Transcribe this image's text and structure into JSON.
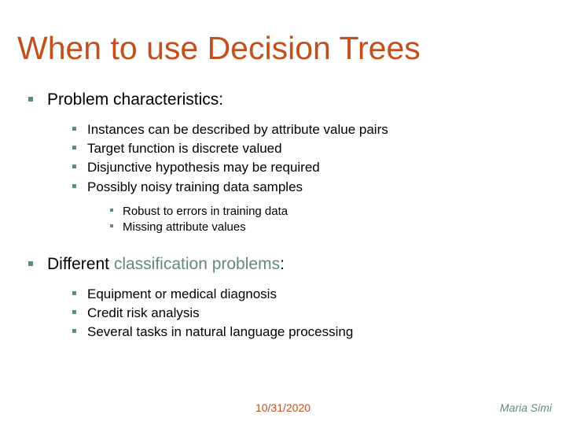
{
  "title": "When to use Decision Trees",
  "section1": {
    "heading": "Problem characteristics:",
    "items": [
      "Instances can be described by attribute value pairs",
      "Target function is discrete valued",
      "Disjunctive hypothesis may be required",
      "Possibly noisy training data samples"
    ],
    "subitems": [
      "Robust to errors in training data",
      "Missing attribute values"
    ]
  },
  "section2": {
    "heading_prefix": "Different ",
    "heading_teal": "classification problems",
    "heading_suffix": ":",
    "items": [
      "Equipment or medical diagnosis",
      "Credit risk analysis",
      "Several tasks in natural language processing"
    ]
  },
  "footer": {
    "date": "10/31/2020",
    "author": "Maria Simi"
  }
}
